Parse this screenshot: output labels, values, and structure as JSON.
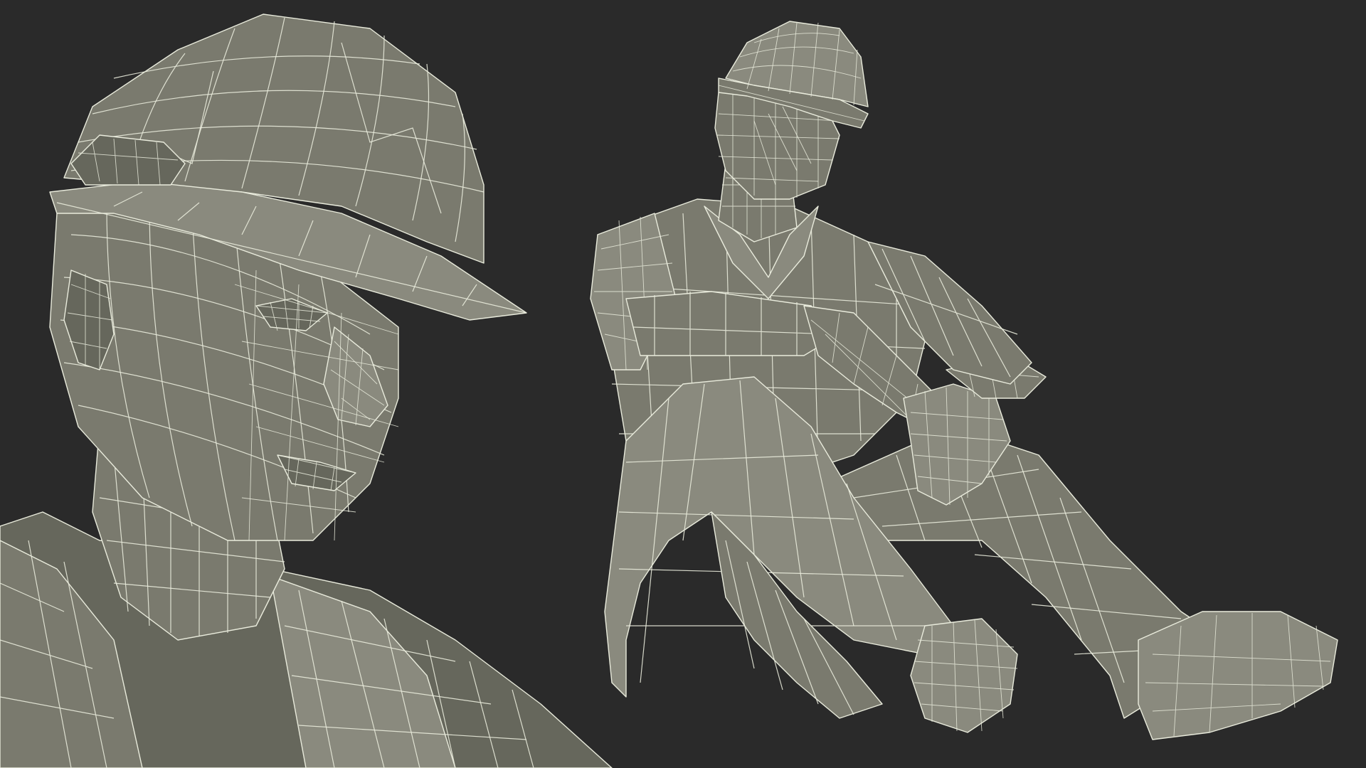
{
  "image": {
    "background_color": "#2a2a2a",
    "mesh_fill_color": "#7a7a6e",
    "wire_color": "#e9ebdc",
    "panels": [
      {
        "id": "closeup",
        "subject": "head-and-shoulders"
      },
      {
        "id": "full",
        "subject": "seated-figure"
      }
    ]
  }
}
